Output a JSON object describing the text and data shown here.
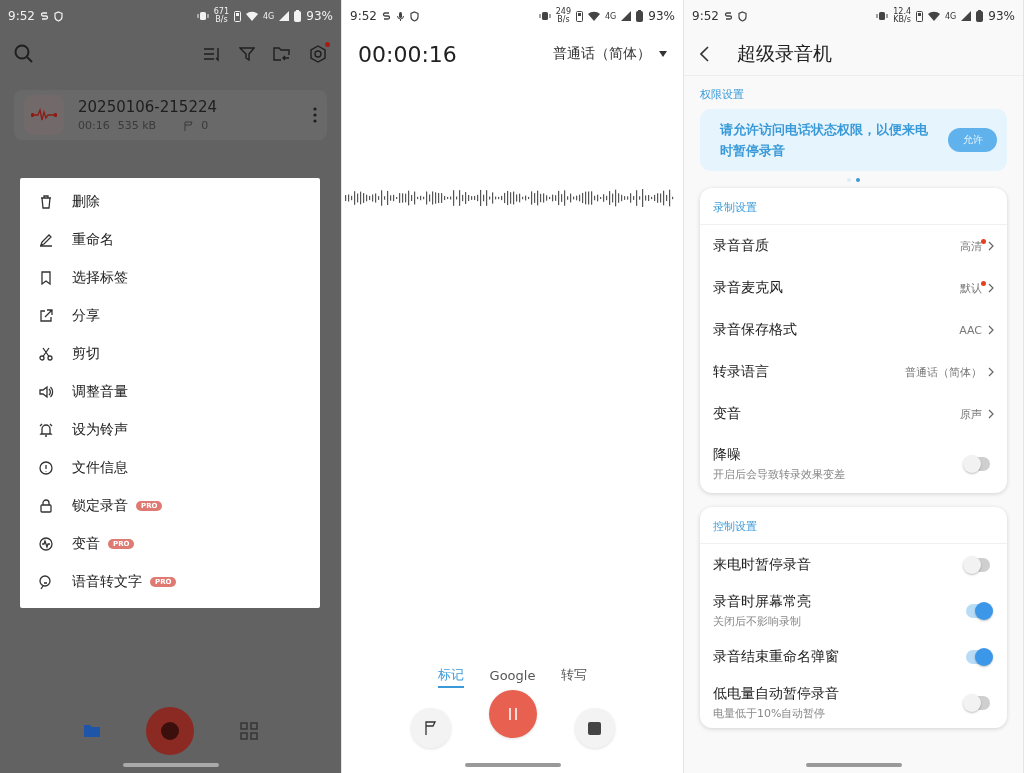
{
  "screens": [
    {
      "kind": "list",
      "status_bar": {
        "time": "9:52",
        "notification_icons": [
          {
            "kind": "s"
          },
          {
            "kind": "shield"
          }
        ],
        "speed": [
          "671",
          "B/s"
        ],
        "network": "4G",
        "battery": "93%"
      },
      "toolbar": {
        "settings_badge": true
      },
      "recording": {
        "name": "20250106-215224",
        "duration": "00:16",
        "size": "535 kB",
        "marks": "0"
      },
      "menu": [
        {
          "label": "删除"
        },
        {
          "label": "重命名"
        },
        {
          "label": "选择标签"
        },
        {
          "label": "分享"
        },
        {
          "label": "剪切"
        },
        {
          "label": "调整音量"
        },
        {
          "label": "设为铃声"
        },
        {
          "label": "文件信息"
        },
        {
          "label": "锁定录音",
          "badge": "PRO"
        },
        {
          "label": "变音",
          "badge": "PRO"
        },
        {
          "label": "语音转文字",
          "badge": "PRO"
        }
      ],
      "bottom_nav": [
        {
          "kind": "folder",
          "selected": true
        },
        {
          "kind": "record"
        },
        {
          "kind": "grid",
          "selected": false
        }
      ]
    },
    {
      "kind": "recorder",
      "status_bar": {
        "time": "9:52",
        "notification_icons": [
          {
            "kind": "s"
          },
          {
            "kind": "mic"
          },
          {
            "kind": "shield"
          }
        ],
        "speed": [
          "249",
          "B/s"
        ],
        "network": "4G",
        "battery": "93%"
      },
      "timer": "00:00:16",
      "language": "普通话（简体）",
      "tabs": [
        {
          "label": "标记",
          "selected": true
        },
        {
          "label": "Google",
          "selected": false
        },
        {
          "label": "转写",
          "selected": false
        }
      ]
    },
    {
      "kind": "settings",
      "status_bar": {
        "time": "9:52",
        "notification_icons": [
          {
            "kind": "s"
          },
          {
            "kind": "shield"
          }
        ],
        "speed": [
          "12.4",
          "KB/s"
        ],
        "network": "4G",
        "battery": "93%"
      },
      "title": "超级录音机",
      "permission": {
        "section": "权限设置",
        "message": "请允许访问电话状态权限，以便来电时暂停录音",
        "button": "允许"
      },
      "pager_dots": [
        {
          "selected": false
        },
        {
          "selected": true
        }
      ],
      "groups": [
        {
          "title": "录制设置",
          "rows": [
            {
              "kind": "nav",
              "label": "录音音质",
              "value": "高清",
              "dot": true
            },
            {
              "kind": "nav",
              "label": "录音麦克风",
              "value": "默认",
              "dot": true
            },
            {
              "kind": "nav",
              "label": "录音保存格式",
              "value": "AAC",
              "dot": false
            },
            {
              "kind": "nav",
              "label": "转录语言",
              "value": "普通话（简体）",
              "dot": false
            },
            {
              "kind": "nav",
              "label": "变音",
              "value": "原声",
              "dot": false
            },
            {
              "kind": "toggle",
              "label": "降噪",
              "subtitle": "开启后会导致转录效果变差",
              "on": false
            }
          ]
        },
        {
          "title": "控制设置",
          "rows": [
            {
              "kind": "toggle",
              "label": "来电时暂停录音",
              "on": false
            },
            {
              "kind": "toggle",
              "label": "录音时屏幕常亮",
              "subtitle": "关闭后不影响录制",
              "on": true
            },
            {
              "kind": "toggle",
              "label": "录音结束重命名弹窗",
              "on": true
            },
            {
              "kind": "toggle",
              "label": "低电量自动暂停录音",
              "subtitle": "电量低于10%自动暂停",
              "on": false
            }
          ]
        }
      ]
    }
  ]
}
